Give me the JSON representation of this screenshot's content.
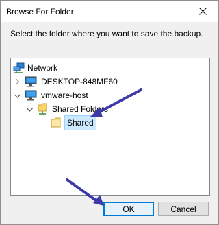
{
  "window": {
    "title": "Browse For Folder",
    "instruction": "Select the folder where you want to save the backup."
  },
  "tree": {
    "nodes": [
      {
        "label": "Network",
        "icon": "network-icon",
        "expander": "none"
      },
      {
        "label": "DESKTOP-848MF60",
        "icon": "computer-icon",
        "expander": "collapsed"
      },
      {
        "label": "vmware-host",
        "icon": "computer-icon",
        "expander": "expanded"
      },
      {
        "label": "Shared Folders",
        "icon": "shared-folder-icon",
        "expander": "expanded"
      },
      {
        "label": "Shared",
        "icon": "folder-icon",
        "expander": "none",
        "selected": true
      }
    ]
  },
  "buttons": {
    "ok": "OK",
    "cancel": "Cancel"
  },
  "colors": {
    "annotation_arrow": "#3d3aa8",
    "selection": "#cce8ff",
    "focus_border": "#0078d7"
  }
}
